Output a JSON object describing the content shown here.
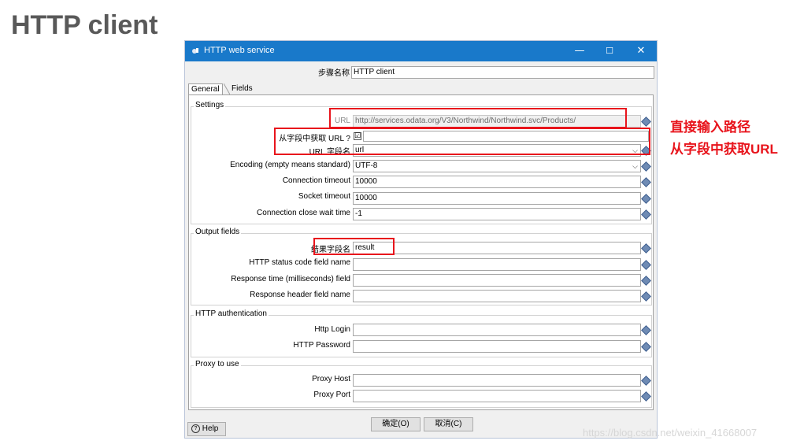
{
  "slide": {
    "title": "HTTP client",
    "annotations": [
      "直接输入路径",
      "从字段中获取URL"
    ],
    "watermark": "https://blog.csdn.net/weixin_41668007"
  },
  "window": {
    "title": "HTTP web service",
    "minimize": "—",
    "maximize": "☐",
    "close": "✕"
  },
  "step": {
    "label": "步骤名称",
    "value": "HTTP client"
  },
  "tabs": [
    "General",
    "Fields"
  ],
  "settings": {
    "title": "Settings",
    "url_label": "URL",
    "url_value": "http://services.odata.org/V3/Northwind/Northwind.svc/Products/",
    "url_from_field_label": "从字段中获取 URL ?",
    "url_from_field_checked": "☑",
    "url_field_name_label": "URL 字段名",
    "url_field_name_value": "url",
    "encoding_label": "Encoding (empty means standard)",
    "encoding_value": "UTF-8",
    "connection_timeout_label": "Connection timeout",
    "connection_timeout_value": "10000",
    "socket_timeout_label": "Socket timeout",
    "socket_timeout_value": "10000",
    "close_wait_label": "Connection close wait time",
    "close_wait_value": "-1"
  },
  "output": {
    "title": "Output fields",
    "result_label": "结果字段名",
    "result_value": "result",
    "status_code_label": "HTTP status code field name",
    "response_time_label": "Response time (milliseconds) field",
    "response_header_label": "Response header field name"
  },
  "auth": {
    "title": "HTTP authentication",
    "login_label": "Http Login",
    "password_label": "HTTP Password"
  },
  "proxy": {
    "title": "Proxy to use",
    "host_label": "Proxy Host",
    "port_label": "Proxy Port"
  },
  "buttons": {
    "ok": "确定(O)",
    "cancel": "取消(C)",
    "help": "Help",
    "help_icon": "?"
  },
  "colors": {
    "accent": "#1979ca",
    "annotation_red": "#e8141c"
  }
}
